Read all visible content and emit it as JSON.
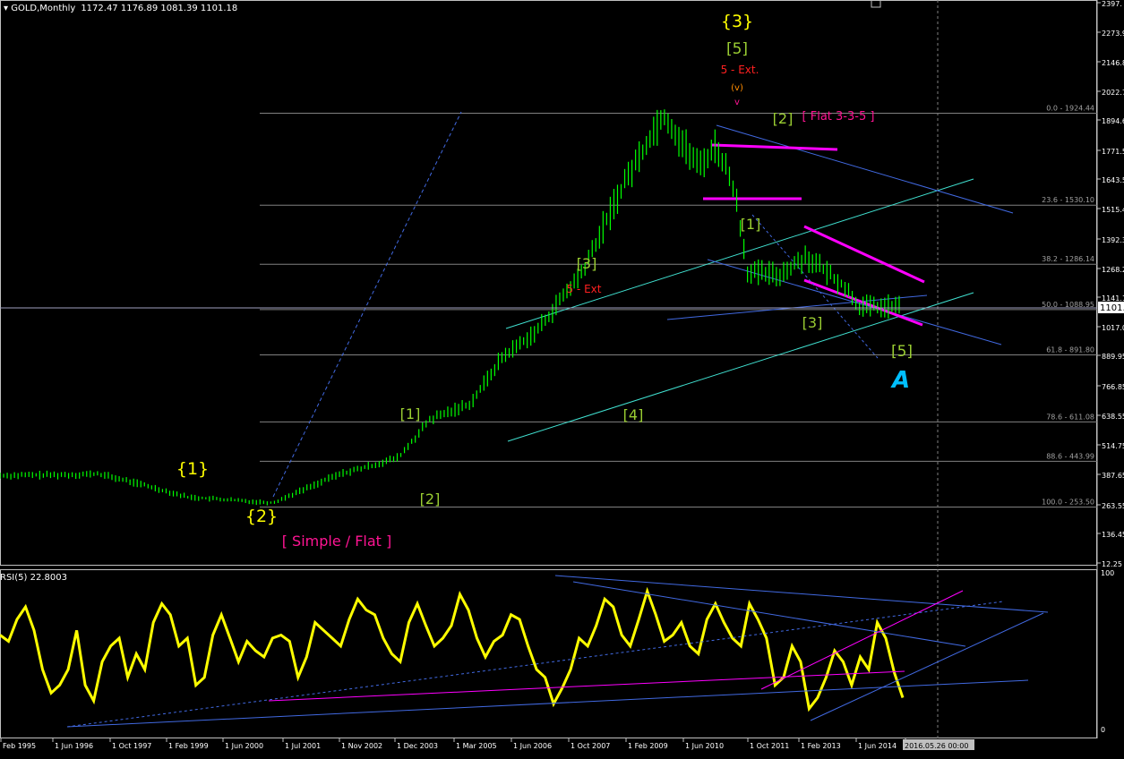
{
  "header": {
    "symbol": "GOLD,Monthly",
    "ohlc": "1172.47 1176.89 1081.39 1101.18",
    "rsi_label": "RSI(5) 22.8003"
  },
  "colors": {
    "background": "#000000",
    "price_bars": "#00ff00",
    "rsi_line": "#ffff00",
    "trendline_blue": "#4169e1",
    "trendline_cyan": "#40e0d0",
    "trendline_magenta": "#ff00ff",
    "fib_level": "#808080",
    "label_red": "#ff2020",
    "label_orange": "#ff8c00",
    "label_green_yellow": "#9acd32",
    "label_yellow": "#ffff00",
    "label_cyan": "#00bfff",
    "label_magenta": "#ff1493"
  },
  "current_price_tag": "1101.",
  "chart_data": [
    {
      "type": "line",
      "title": "GOLD,Monthly",
      "xlabel": "",
      "ylabel": "",
      "x_ticks": [
        "Feb 1995",
        "1 Jun 1996",
        "1 Oct 1997",
        "1 Feb 1999",
        "1 Jun 2000",
        "1 Jul 2001",
        "1 Nov 2002",
        "1 Dec 2003",
        "1 Mar 2005",
        "1 Jun 2006",
        "1 Oct 2007",
        "1 Feb 2009",
        "1 Jun 2010",
        "1 Oct 2011",
        "1 Feb 2013",
        "1 Jun 2014",
        "2016.05.26 00:00"
      ],
      "y_ticks": [
        "2397.",
        "2273.95",
        "2146.85",
        "2022.75",
        "1894.65",
        "1771.55",
        "1643.55",
        "1515.45",
        "1392.35",
        "1268.25",
        "1141.15",
        "1017.05",
        "889.95",
        "766.85",
        "638.55",
        "514.75",
        "387.65",
        "263.55",
        "136.45",
        "12.25"
      ],
      "ylim": [
        12.25,
        2397
      ],
      "series": [
        {
          "values": [
            {
              "x": "1993",
              "y": 383
            },
            {
              "x": "1994",
              "y": 385
            },
            {
              "x": "1995",
              "y": 386
            },
            {
              "x": "1996",
              "y": 390
            },
            {
              "x": "1997",
              "y": 345
            },
            {
              "x": "1998",
              "y": 295
            },
            {
              "x": "1999",
              "y": 285
            },
            {
              "x": "2000",
              "y": 275
            },
            {
              "x": "2001",
              "y": 272
            },
            {
              "x": "2002",
              "y": 320
            },
            {
              "x": "2003",
              "y": 390
            },
            {
              "x": "2004",
              "y": 420
            },
            {
              "x": "2005",
              "y": 460
            },
            {
              "x": "2006",
              "y": 620
            },
            {
              "x": "2007",
              "y": 690
            },
            {
              "x": "2008",
              "y": 880
            },
            {
              "x": "2009",
              "y": 1000
            },
            {
              "x": "2010",
              "y": 1250
            },
            {
              "x": "2011",
              "y": 1650
            },
            {
              "x": "2011-09",
              "y": 1920
            },
            {
              "x": "2012",
              "y": 1700
            },
            {
              "x": "2012-10",
              "y": 1790
            },
            {
              "x": "2013",
              "y": 1600
            },
            {
              "x": "2013-06",
              "y": 1250
            },
            {
              "x": "2014",
              "y": 1240
            },
            {
              "x": "2014-06",
              "y": 1320
            },
            {
              "x": "2015",
              "y": 1200
            },
            {
              "x": "2015-11",
              "y": 1101
            }
          ]
        }
      ],
      "fibonacci_levels": [
        {
          "label": "0.0 - 1924.44",
          "value": 1924.44
        },
        {
          "label": "23.6 - 1530.10",
          "value": 1530.1
        },
        {
          "label": "38.2 - 1286.14",
          "value": 1286.14
        },
        {
          "label": "50.0 - 1088.95",
          "value": 1088.95
        },
        {
          "label": "61.8 - 891.80",
          "value": 891.8
        },
        {
          "label": "78.6 - 611.08",
          "value": 611.08
        },
        {
          "label": "88.6 - 443.99",
          "value": 443.99
        },
        {
          "label": "100.0 - 253.50",
          "value": 253.5
        }
      ],
      "wave_labels": [
        {
          "text": "{3}",
          "group": "yellow"
        },
        {
          "text": "[5]",
          "group": "green"
        },
        {
          "text": "5 - Ext.",
          "group": "red"
        },
        {
          "text": "(v)",
          "group": "orange"
        },
        {
          "text": "v",
          "group": "magenta"
        },
        {
          "text": "[2]",
          "group": "green"
        },
        {
          "text": "[ Flat 3-3-5 ]",
          "group": "magenta"
        },
        {
          "text": "{1}",
          "group": "yellow"
        },
        {
          "text": "{2}",
          "group": "yellow"
        },
        {
          "text": "[ Simple / Flat ]",
          "group": "magenta"
        },
        {
          "text": "[1]",
          "group": "green"
        },
        {
          "text": "[2]",
          "group": "green"
        },
        {
          "text": "[3]",
          "group": "green"
        },
        {
          "text": "[4]",
          "group": "green"
        },
        {
          "text": "5 - Ext",
          "group": "red"
        },
        {
          "text": "[3]",
          "group": "green"
        },
        {
          "text": "[5]",
          "group": "green"
        },
        {
          "text": "[1]",
          "group": "green"
        },
        {
          "text": "A",
          "group": "cyan"
        }
      ]
    },
    {
      "type": "line",
      "title": "RSI(5) 22.8003",
      "xlabel": "",
      "ylabel": "",
      "y_ticks": [
        "100",
        "0"
      ],
      "ylim": [
        0,
        100
      ],
      "series": [
        {
          "values": [
            62,
            58,
            72,
            80,
            65,
            40,
            25,
            30,
            40,
            65,
            30,
            20,
            45,
            55,
            60,
            35,
            50,
            40,
            70,
            82,
            75,
            55,
            60,
            30,
            35,
            62,
            75,
            60,
            45,
            58,
            52,
            48,
            60,
            62,
            58,
            35,
            48,
            70,
            65,
            60,
            55,
            72,
            85,
            78,
            75,
            60,
            50,
            45,
            70,
            82,
            68,
            55,
            60,
            68,
            88,
            78,
            60,
            48,
            58,
            62,
            75,
            72,
            55,
            40,
            35,
            18,
            28,
            40,
            60,
            55,
            68,
            85,
            80,
            62,
            55,
            72,
            90,
            75,
            58,
            62,
            70,
            55,
            50,
            72,
            82,
            70,
            60,
            55,
            82,
            72,
            60,
            30,
            35,
            55,
            45,
            15,
            22,
            35,
            52,
            45,
            30,
            48,
            40,
            70,
            60,
            38,
            22
          ]
        }
      ]
    }
  ]
}
